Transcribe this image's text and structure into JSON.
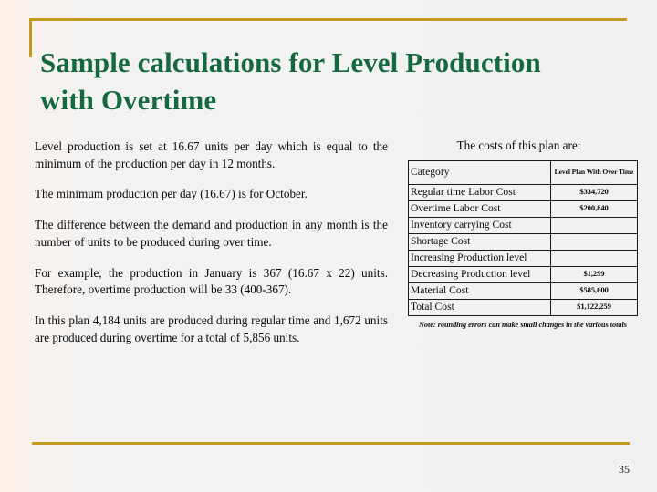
{
  "slide": {
    "title": "Sample calculations for Level Production with Overtime",
    "page_number": "35",
    "accent_color": "#c49a23",
    "title_color": "#16693f"
  },
  "body": {
    "paragraphs": [
      "Level production is set at 16.67 units per day which is equal to the minimum of the production per day in 12 months.",
      "The minimum production per day (16.67) is for October.",
      "The difference between the demand and production in any month is the number of units to be produced during over time.",
      "For example, the production in January is 367 (16.67 x 22) units. Therefore, overtime production will be 33 (400-367).",
      "In this plan 4,184 units are produced during regular time and 1,672 units are produced during overtime for a total of 5,856 units."
    ]
  },
  "costs": {
    "heading": "The costs of this plan are:",
    "columns": [
      "Category",
      "Level Plan With Over Time"
    ],
    "rows": [
      {
        "category": "Regular time Labor Cost",
        "value": "$334,720"
      },
      {
        "category": "Overtime Labor Cost",
        "value": "$200,840"
      },
      {
        "category": "Inventory carrying Cost",
        "value": ""
      },
      {
        "category": "Shortage Cost",
        "value": ""
      },
      {
        "category": "Increasing Production level",
        "value": ""
      },
      {
        "category": "Decreasing Production level",
        "value": "$1,299"
      },
      {
        "category": "Material Cost",
        "value": "$585,600"
      },
      {
        "category": "Total Cost",
        "value": "$1,122,259"
      }
    ],
    "note": "Note: rounding errors can make small changes in the various totals"
  }
}
